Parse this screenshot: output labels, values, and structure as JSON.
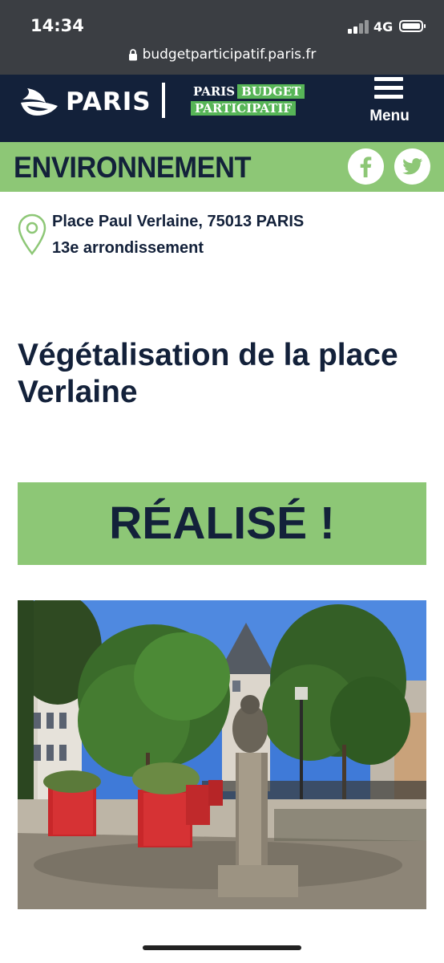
{
  "status_bar": {
    "time": "14:34",
    "network": "4G"
  },
  "browser": {
    "url": "budgetparticipatif.paris.fr"
  },
  "header": {
    "city_name": "PARIS",
    "bp_logo_line1_a": "PARIS",
    "bp_logo_line1_b": "BUDGET",
    "bp_logo_line2": "PARTICIPATIF",
    "menu_label": "Menu"
  },
  "category": {
    "title": "ENVIRONNEMENT"
  },
  "share": {
    "icons": [
      "facebook-icon",
      "twitter-icon"
    ]
  },
  "project": {
    "address": "Place Paul Verlaine, 75013 PARIS",
    "district": "13e arrondissement",
    "title": "Végétalisation de la place Verlaine",
    "status": "RÉALISÉ !"
  },
  "colors": {
    "navy": "#13213a",
    "green": "#8dc776",
    "status_bar": "#3b3e43"
  }
}
